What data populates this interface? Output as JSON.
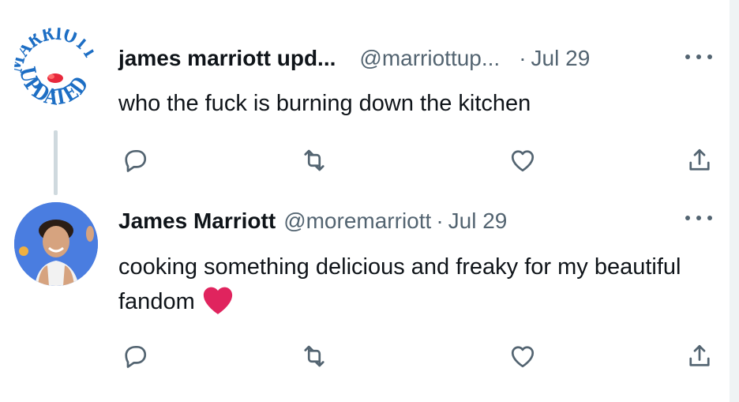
{
  "tweets": [
    {
      "display_name": "james marriott upd...",
      "handle": "@marriottup...",
      "separator": "·",
      "date": "Jul 29",
      "text": "who the fuck is burning down the kitchen",
      "avatar_icon": "marriott-updated-logo",
      "avatar_text_top": "MARRIOTT",
      "avatar_text_bottom": "UPDATED"
    },
    {
      "display_name": "James Marriott",
      "handle": "@moremarriott",
      "separator": "·",
      "date": "Jul 29",
      "text": "cooking something delicious and freaky for my beautiful fandom",
      "avatar_icon": "profile-photo",
      "emoji": "red-heart"
    }
  ],
  "icons": {
    "reply": "reply-icon",
    "retweet": "retweet-icon",
    "like": "like-icon",
    "share": "share-icon",
    "more": "more-icon"
  },
  "colors": {
    "text_primary": "#0f1419",
    "text_secondary": "#536471",
    "thread_line": "#cfd9de",
    "heart": "#e0245e",
    "logo_blue": "#1d6ec4"
  }
}
